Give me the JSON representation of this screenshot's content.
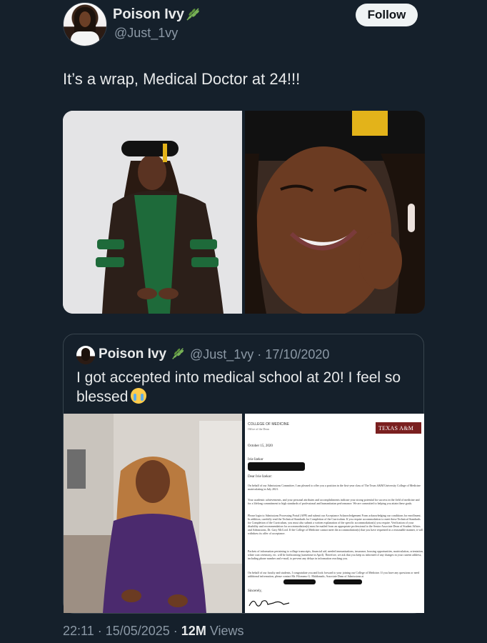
{
  "author": {
    "display_name": "Poison Ivy",
    "handle": "@Just_1vy",
    "badge_icon": "herb-leaf-icon"
  },
  "follow_label": "Follow",
  "tweet_text": "It’s a wrap, Medical Doctor at 24!!!",
  "quoted": {
    "display_name": "Poison Ivy",
    "handle_date": "@Just_1vy · 17/10/2020",
    "text": "I got accepted into medical school at 20! I feel so blessed",
    "emoji": "loudly-crying-face-icon",
    "letter": {
      "header": "COLLEGE OF MEDICINE",
      "subheader": "Office of the Dean",
      "logo": "TEXAS A&M",
      "date": "October 15, 2020",
      "greeting": "Dear Ivie Izekor:",
      "p1": "On behalf of our Admissions Committee, I am pleased to offer you a position in the first-year class of The Texas A&M University College of Medicine matriculating in July 2021.",
      "p2": "Your academic achievements, and your personal attributes and accomplishments indicate your strong potential for success in the field of medicine and for a lifelong commitment to high standards of professional and humanitarian performance. We are committed to helping you attain these goals.",
      "p3": "Please login to Admissions Processing Portal (APP) and submit our Acceptance Acknowledgement Form acknowledging our conditions for enrollment. In addition, carefully read the Technical Standards for Completion of the Curriculum. If you require accommodation to meet these Technical Standards for Completion of the Curriculum, you must also submit a written explanation of the specific accommodation(s) you require. Verification of your disability and recommendation for accommodation(s) must be mailed from an appropriate professional to the Senior Associate Dean of Student Affairs and Admissions, Dr. Gary McCord. If the College of Medicine cannot meet the accommodation(s) that you have requested in a reasonable manner, it will withdraw its offer of acceptance.",
      "p4": "Packets of information pertaining to college transcripts, financial aid, needed immunizations, insurance, housing opportunities, matriculation, orientation, white coat ceremony, etc. will be forthcoming (sometime in April). Therefore, we ask that you keep us informed of any changes in your current address, including phone number and e-mail, to prevent any delays in information reaching you.",
      "p5": "On behalf of our faculty and students, I congratulate you and look forward to your joining our College of Medicine. If you have any questions or need additional information, please contact Mr. Filomeno G. Maldonado, Associate Dean of Admissions at",
      "closing": "Sincerely,"
    }
  },
  "meta": {
    "time_date": "22:11 · 15/05/2025 · ",
    "views_count": "12M",
    "views_label": " Views"
  }
}
